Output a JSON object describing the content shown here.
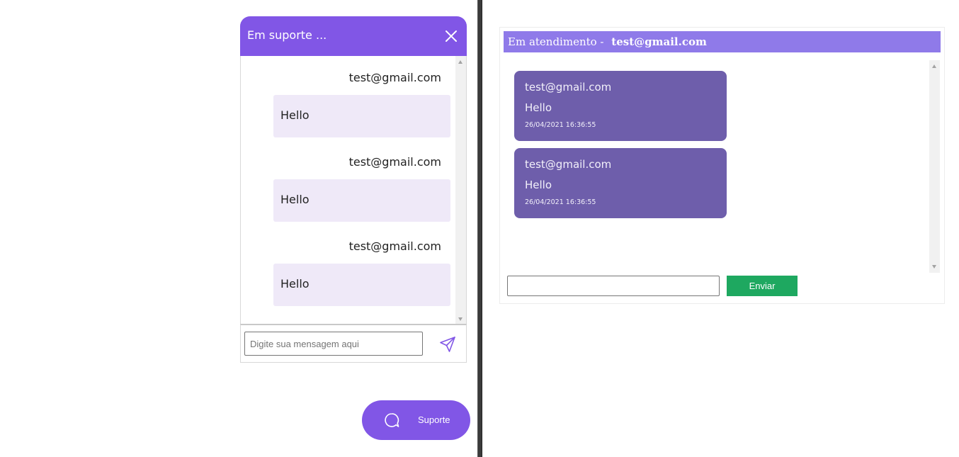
{
  "support_widget": {
    "title": "Em suporte ...",
    "close_icon": "close-icon",
    "messages": [
      {
        "sender": "test@gmail.com",
        "text": "Hello"
      },
      {
        "sender": "test@gmail.com",
        "text": "Hello"
      },
      {
        "sender": "test@gmail.com",
        "text": "Hello"
      }
    ],
    "input_placeholder": "Digite sua mensagem aqui",
    "send_icon": "send-icon",
    "accent_color": "#8156e6",
    "bubble_color": "#efe9f8"
  },
  "support_fab": {
    "label": "Suporte",
    "icon": "chat-bubble-icon"
  },
  "agent_panel": {
    "header_prefix": "Em atendimento -",
    "header_email": "test@gmail.com",
    "header_color": "#8f7ae9",
    "messages": [
      {
        "sender": "test@gmail.com",
        "text": "Hello",
        "timestamp": "26/04/2021 16:36:55"
      },
      {
        "sender": "test@gmail.com",
        "text": "Hello",
        "timestamp": "26/04/2021 16:36:55"
      }
    ],
    "message_color": "#6e5eab",
    "input_value": "",
    "send_label": "Enviar",
    "send_color": "#1ea860"
  }
}
